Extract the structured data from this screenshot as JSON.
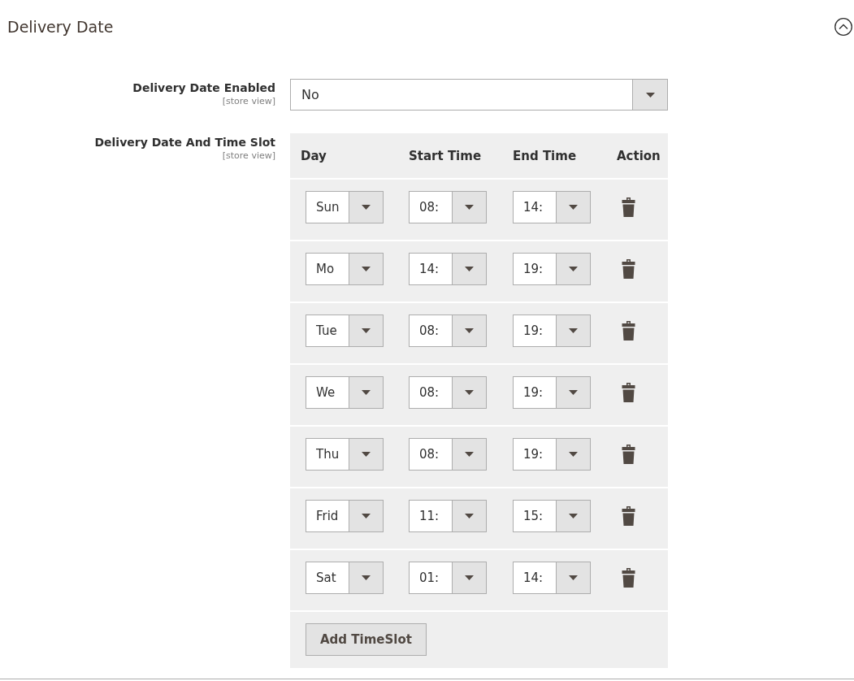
{
  "section": {
    "title": "Delivery Date",
    "expanded": true
  },
  "fields": [
    {
      "kind": "select",
      "label": "Delivery Date Enabled",
      "scope": "[store view]",
      "value": "No"
    },
    {
      "kind": "timeslots",
      "label": "Delivery Date And Time Slot",
      "scope": "[store view]",
      "columns": [
        "Day",
        "Start Time",
        "End Time",
        "Action"
      ],
      "rows": [
        {
          "day": "Sun",
          "start": "08:",
          "end": "14:"
        },
        {
          "day": "Mo",
          "start": "14:",
          "end": "19:"
        },
        {
          "day": "Tue",
          "start": "08:",
          "end": "19:"
        },
        {
          "day": "We",
          "start": "08:",
          "end": "19:"
        },
        {
          "day": "Thu",
          "start": "08:",
          "end": "19:"
        },
        {
          "day": "Frid",
          "start": "11:",
          "end": "15:"
        },
        {
          "day": "Sat",
          "start": "01:",
          "end": "14:"
        }
      ],
      "add_button": "Add TimeSlot"
    }
  ]
}
